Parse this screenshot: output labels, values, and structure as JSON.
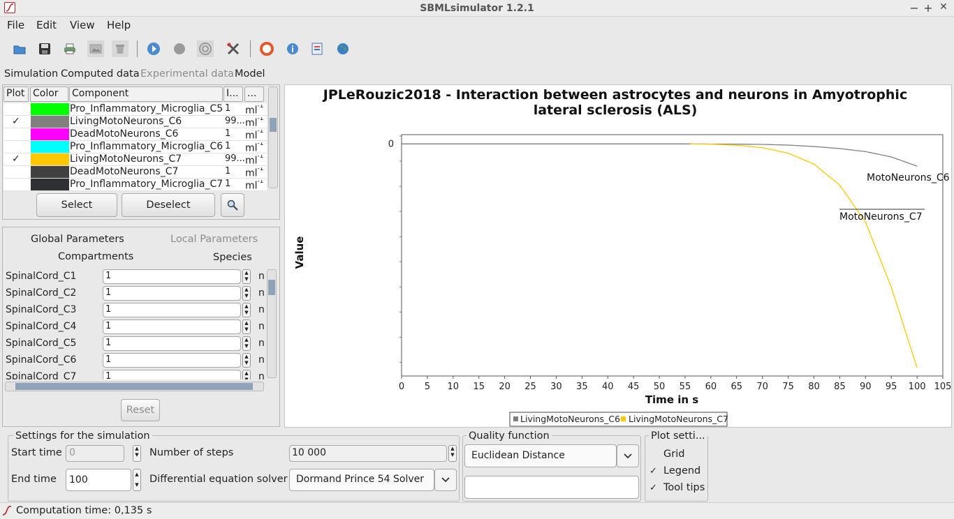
{
  "window": {
    "title": "SBMLsimulator 1.2.1",
    "minimize": "−",
    "maximize": "+",
    "close": "✕"
  },
  "menu": [
    "File",
    "Edit",
    "View",
    "Help"
  ],
  "toolbar_icons": [
    "open-icon",
    "save-icon",
    "print-icon",
    "export-image-icon",
    "trash-icon",
    "play-icon",
    "stop-icon",
    "optimize-icon",
    "settings-icon",
    "help-icon",
    "info-icon",
    "license-icon",
    "online-update-icon"
  ],
  "tabs": [
    "Simulation",
    "Computed data",
    "Experimental data",
    "Model"
  ],
  "species_table": {
    "headers": [
      "Plot",
      "Color",
      "Component",
      "I...",
      "..."
    ],
    "rows": [
      {
        "plot": "",
        "color": "#00ff00",
        "name": "Pro_Inflammatory_Microglia_C5",
        "value": "1",
        "unit": "ml",
        "exp": "-1"
      },
      {
        "plot": "✓",
        "color": "#808080",
        "name": "LivingMotoNeurons_C6",
        "value": "99...",
        "unit": "ml",
        "exp": "-1"
      },
      {
        "plot": "",
        "color": "#ff00ff",
        "name": "DeadMotoNeurons_C6",
        "value": "1",
        "unit": "ml",
        "exp": "-1"
      },
      {
        "plot": "",
        "color": "#00ffff",
        "name": "Pro_Inflammatory_Microglia_C6",
        "value": "1",
        "unit": "ml",
        "exp": "-1"
      },
      {
        "plot": "✓",
        "color": "#ffc800",
        "name": "LivingMotoNeurons_C7",
        "value": "99...",
        "unit": "ml",
        "exp": "-1"
      },
      {
        "plot": "",
        "color": "#404040",
        "name": "DeadMotoNeurons_C7",
        "value": "1",
        "unit": "ml",
        "exp": "-1"
      },
      {
        "plot": "",
        "color": "#2f3033",
        "name": "Pro_Inflammatory_Microglia_C7",
        "value": "1",
        "unit": "ml",
        "exp": "-1"
      }
    ],
    "select_label": "Select",
    "deselect_label": "Deselect",
    "zoom_icon": "magnifier-icon"
  },
  "parameters": {
    "tabs": [
      "Global Parameters",
      "Local Parameters",
      "Compartments",
      "Species"
    ],
    "rows": [
      {
        "label": "SpinalCord_C1",
        "value": "1",
        "unit": "n"
      },
      {
        "label": "SpinalCord_C2",
        "value": "1",
        "unit": "n"
      },
      {
        "label": "SpinalCord_C3",
        "value": "1",
        "unit": "n"
      },
      {
        "label": "SpinalCord_C4",
        "value": "1",
        "unit": "n"
      },
      {
        "label": "SpinalCord_C5",
        "value": "1",
        "unit": "n"
      },
      {
        "label": "SpinalCord_C6",
        "value": "1",
        "unit": "n"
      },
      {
        "label": "SpinalCord_C7",
        "value": "1",
        "unit": "n"
      }
    ],
    "reset_label": "Reset"
  },
  "chart_data": {
    "type": "line",
    "title": "JPLeRouzic2018 - Interaction between astrocytes and neurons in Amyotrophic lateral sclerosis (ALS)",
    "xlabel": "Time in s",
    "ylabel": "Value",
    "xlim": [
      0,
      105
    ],
    "x_ticks": [
      0,
      5,
      10,
      15,
      20,
      25,
      30,
      35,
      40,
      45,
      50,
      55,
      60,
      65,
      70,
      75,
      80,
      85,
      90,
      95,
      100,
      105
    ],
    "y_ticks": [
      0
    ],
    "series": [
      {
        "name": "LivingMotoNeurons_C6",
        "color": "#808080",
        "label": "MotoNeurons_C6",
        "x": [
          0,
          55,
          65,
          70,
          75,
          80,
          85,
          90,
          95,
          100
        ],
        "y": [
          0,
          0,
          -0.1,
          -0.2,
          -0.5,
          -1.1,
          -2.0,
          -3.3,
          -5.6,
          -9.6
        ]
      },
      {
        "name": "LivingMotoNeurons_C7",
        "color": "#ffc800",
        "label": "MotoNeurons_C7",
        "x": [
          56,
          60,
          65,
          70,
          75,
          80,
          85,
          90,
          95,
          100
        ],
        "y": [
          0,
          -0.1,
          -0.6,
          -1.6,
          -4.0,
          -8.7,
          -17.7,
          -33.7,
          -61.7,
          -96.4
        ]
      }
    ],
    "ylim": [
      -100,
      4
    ],
    "legend_position": "bottom",
    "grid": false
  },
  "settings": {
    "title": "Settings for the simulation",
    "start_label": "Start time",
    "start_value": "0",
    "end_label": "End time",
    "end_value": "100",
    "steps_label": "Number of steps",
    "steps_value": "10 000",
    "solver_label": "Differential equation solver",
    "solver_value": "Dormand Prince 54 Solver"
  },
  "quality": {
    "title": "Quality function",
    "value": "Euclidean Distance",
    "extra": ""
  },
  "plot_settings": {
    "title": "Plot setti...",
    "items": [
      {
        "label": "Grid",
        "checked": ""
      },
      {
        "label": "Legend",
        "checked": "✓"
      },
      {
        "label": "Tool tips",
        "checked": "✓"
      }
    ]
  },
  "status": {
    "text": "Computation time: 0,135 s"
  }
}
